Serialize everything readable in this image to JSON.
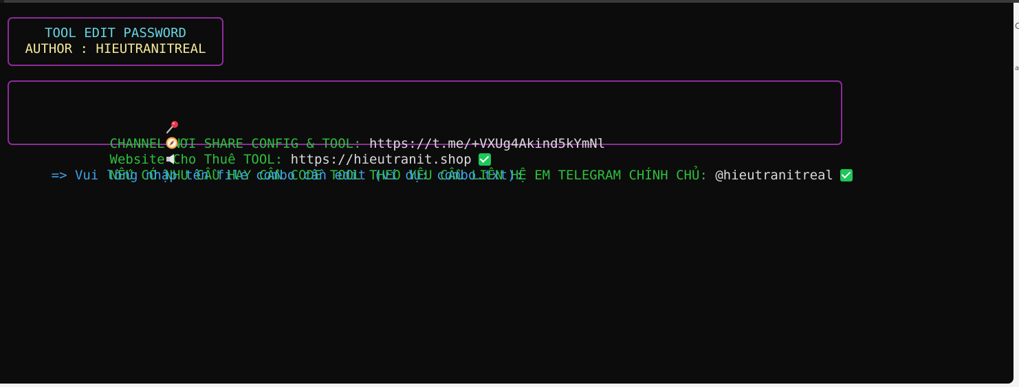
{
  "header_box": {
    "title": "TOOL EDIT PASSWORD",
    "author": "AUTHOR : HIEUTRANITREAL"
  },
  "links_box": {
    "lines": [
      {
        "icon": "pushpin-icon",
        "label": "CHANNEL NƠI SHARE CONFIG & TOOL: ",
        "value": "https://t.me/+VXUg4Akind5kYmNl",
        "check": false
      },
      {
        "icon": "compass-icon",
        "label": "Website Cho Thuê TOOL: ",
        "value": "https://hieutranit.shop",
        "check": true
      },
      {
        "icon": "speaker-icon",
        "label": "NẾU CÓ NHU CẦU HAY CẦN CODE TOOL THEO YÊU CẦU LIÊN HỆ EM TELEGRAM CHÍNH CHỦ: ",
        "value": "@hieutranitreal",
        "check": true
      }
    ]
  },
  "prompt": {
    "text": "=> Vui lòng nhập tên file combo cần edit (ví dụ: combo.txt):",
    "input_value": ""
  },
  "colors": {
    "background": "#0c0c0c",
    "border": "#8e2c9c",
    "title": "#66d4e2",
    "author": "#f3e99a",
    "label": "#2ebf3e",
    "value": "#dadada",
    "prompt": "#3ea3e8",
    "check": "#1fc75a"
  }
}
